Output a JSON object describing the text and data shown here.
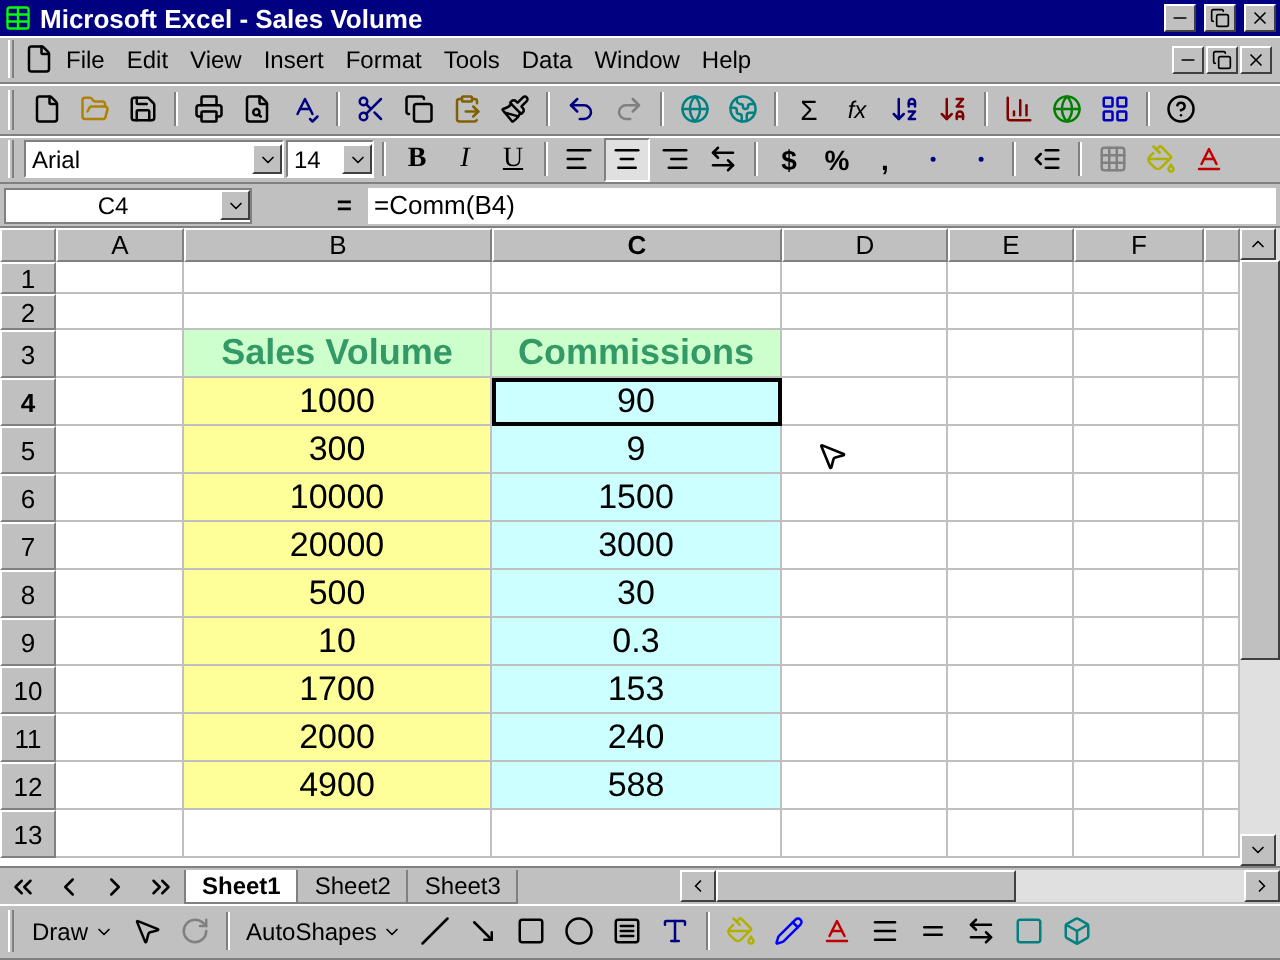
{
  "window": {
    "title": "Microsoft Excel - Sales Volume"
  },
  "menu": [
    "File",
    "Edit",
    "View",
    "Insert",
    "Format",
    "Tools",
    "Data",
    "Window",
    "Help"
  ],
  "standard_toolbar": {
    "sum": "Σ",
    "function": "fx"
  },
  "formatting_toolbar": {
    "font": "Arial",
    "size": "14",
    "styles": [
      {
        "label": "B",
        "selected": false
      },
      {
        "label": "I",
        "selected": false
      },
      {
        "label": "U",
        "selected": false
      }
    ],
    "alignment": [
      {
        "selected": false
      },
      {
        "selected": true
      },
      {
        "selected": false
      }
    ],
    "currency": "$",
    "percent": "%",
    "comma": ","
  },
  "formula_bar": {
    "name_box": "C4",
    "equals": "=",
    "formula": "=Comm(B4)"
  },
  "sheet": {
    "columns": [
      {
        "label": "A",
        "selected": false
      },
      {
        "label": "B",
        "selected": false
      },
      {
        "label": "C",
        "selected": true
      },
      {
        "label": "D",
        "selected": false
      },
      {
        "label": "E",
        "selected": false
      },
      {
        "label": "F",
        "selected": false
      }
    ],
    "rows": [
      {
        "label": "1",
        "kind": "blank",
        "selected": false
      },
      {
        "label": "2",
        "kind": "blank",
        "selected": false
      },
      {
        "label": "3",
        "kind": "header",
        "selected": false,
        "b": "Sales Volume",
        "c": "Commissions"
      },
      {
        "label": "4",
        "kind": "value",
        "selected": true,
        "b": "1000",
        "c": "90"
      },
      {
        "label": "5",
        "kind": "value",
        "selected": false,
        "b": "300",
        "c": "9"
      },
      {
        "label": "6",
        "kind": "value",
        "selected": false,
        "b": "10000",
        "c": "1500"
      },
      {
        "label": "7",
        "kind": "value",
        "selected": false,
        "b": "20000",
        "c": "3000"
      },
      {
        "label": "8",
        "kind": "value",
        "selected": false,
        "b": "500",
        "c": "30"
      },
      {
        "label": "9",
        "kind": "value",
        "selected": false,
        "b": "10",
        "c": "0.3"
      },
      {
        "label": "10",
        "kind": "value",
        "selected": false,
        "b": "1700",
        "c": "153"
      },
      {
        "label": "11",
        "kind": "value",
        "selected": false,
        "b": "2000",
        "c": "240"
      },
      {
        "label": "12",
        "kind": "value",
        "selected": false,
        "b": "4900",
        "c": "588"
      },
      {
        "label": "13",
        "kind": "blank",
        "selected": false
      }
    ]
  },
  "sheet_tabs": [
    {
      "label": "Sheet1",
      "selected": true
    },
    {
      "label": "Sheet2",
      "selected": false
    },
    {
      "label": "Sheet3",
      "selected": false
    }
  ],
  "draw_toolbar": {
    "draw": "Draw",
    "autoshapes": "AutoShapes"
  }
}
